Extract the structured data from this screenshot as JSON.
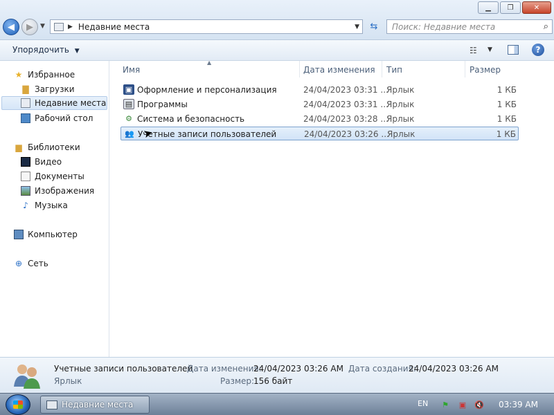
{
  "window": {
    "address_path": "Недавние места",
    "search_placeholder": "Поиск: Недавние места"
  },
  "toolbar": {
    "organize_label": "Упорядочить"
  },
  "sidebar": {
    "favorites": "Избранное",
    "downloads": "Загрузки",
    "recent_places": "Недавние места",
    "desktop": "Рабочий стол",
    "libraries": "Библиотеки",
    "video": "Видео",
    "documents": "Документы",
    "images": "Изображения",
    "music": "Музыка",
    "computer": "Компьютер",
    "network": "Сеть"
  },
  "columns": {
    "name": "Имя",
    "modified": "Дата изменения",
    "type": "Тип",
    "size": "Размер"
  },
  "files": [
    {
      "name": "Оформление и персонализация",
      "modified": "24/04/2023 03:31 ...",
      "type": "Ярлык",
      "size": "1 КБ",
      "icon": "personalization-icon"
    },
    {
      "name": "Программы",
      "modified": "24/04/2023 03:31 ...",
      "type": "Ярлык",
      "size": "1 КБ",
      "icon": "programs-icon"
    },
    {
      "name": "Система и безопасность",
      "modified": "24/04/2023 03:28 ...",
      "type": "Ярлык",
      "size": "1 КБ",
      "icon": "system-security-icon"
    },
    {
      "name": "Учетные записи пользователей",
      "modified": "24/04/2023 03:26 ...",
      "type": "Ярлык",
      "size": "1 КБ",
      "icon": "user-accounts-icon",
      "selected": true
    }
  ],
  "details": {
    "name": "Учетные записи пользователей",
    "type": "Ярлык",
    "modified_label": "Дата изменения:",
    "modified_value": "24/04/2023 03:26 AM",
    "created_label": "Дата создания:",
    "created_value": "24/04/2023 03:26 AM",
    "size_label": "Размер:",
    "size_value": "156 байт"
  },
  "taskbar": {
    "window_button": "Недавние места",
    "language": "EN",
    "clock": "03:39 AM"
  }
}
